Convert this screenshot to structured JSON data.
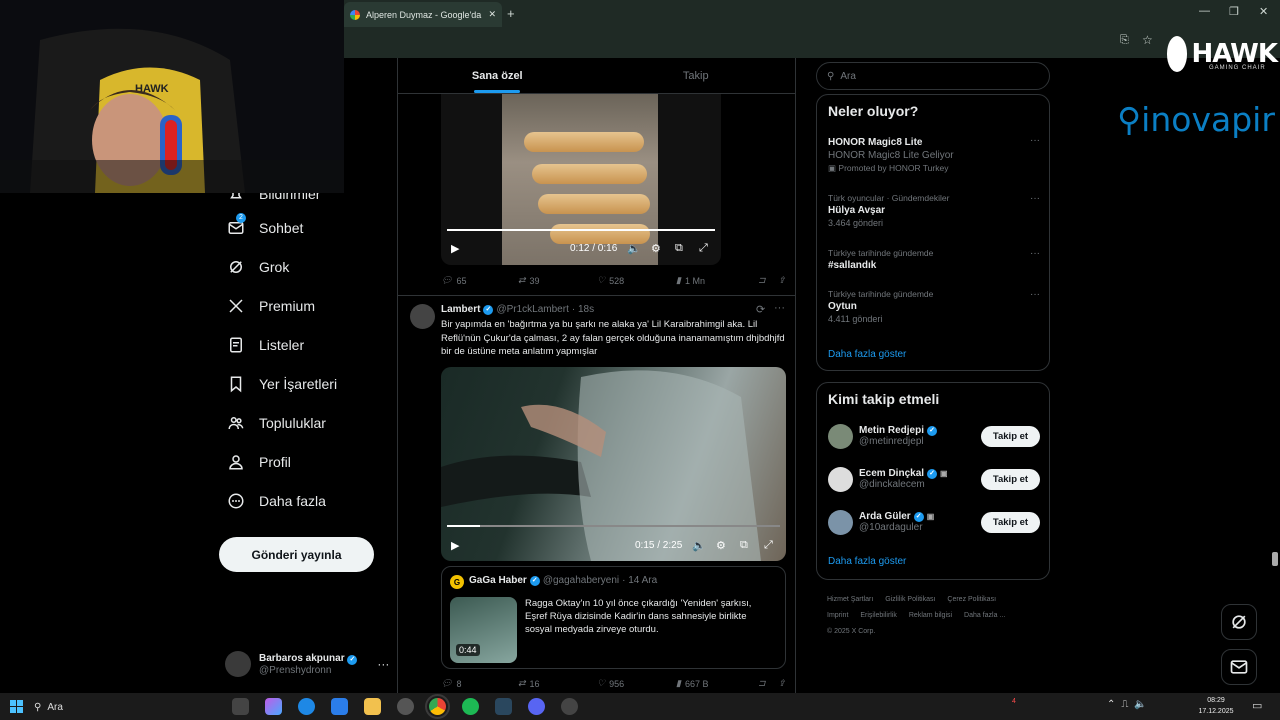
{
  "browser": {
    "tab_title": "Alperen Duymaz - Google'da A",
    "new_tab": "+",
    "win_min": "—",
    "win_restore": "❐",
    "win_close": "✕"
  },
  "overlay": {
    "brand": "HAWK",
    "brand_sub": "GAMING CHAIR",
    "sponsor": "inovapir"
  },
  "nav": {
    "items": [
      {
        "label": "Bildirimler",
        "icon": "bell-icon"
      },
      {
        "label": "Sohbet",
        "icon": "chat-icon",
        "badge": "2"
      },
      {
        "label": "Grok",
        "icon": "grok-icon"
      },
      {
        "label": "Premium",
        "icon": "x-icon"
      },
      {
        "label": "Listeler",
        "icon": "list-icon"
      },
      {
        "label": "Yer İşaretleri",
        "icon": "bookmark-icon"
      },
      {
        "label": "Topluluklar",
        "icon": "people-icon"
      },
      {
        "label": "Profil",
        "icon": "person-icon"
      },
      {
        "label": "Daha fazla",
        "icon": "more-circle-icon"
      }
    ],
    "post_button": "Gönderi yayınla",
    "account_name": "Barbaros akpunar",
    "account_handle": "@Prenshydronn",
    "account_more": "···"
  },
  "feed": {
    "tabs": [
      "Sana özel",
      "Takip"
    ],
    "post1": {
      "video_time": "0:12 / 0:16",
      "video_progress": 1.0,
      "replies": "65",
      "reposts": "39",
      "likes": "528",
      "views": "1 Mn"
    },
    "post2": {
      "name": "Lambert",
      "handle": "@Pr1ckLambert",
      "time": "· 18s",
      "text": "Bir yapımda en 'bağırtma ya bu şarkı ne alaka ya' Lil Karaibrahimgil aka. Lil Reflü'nün Çukur'da çalması, 2 ay falan gerçek olduğuna inanamamıştım dhjbdhjfd bir de üstüne meta anlatım yapmışlar",
      "video_time": "0:15 / 2:25",
      "video_progress": 0.1,
      "quote": {
        "name": "GaGa Haber",
        "handle": "@gagahaberyeni",
        "time": "· 14 Ara",
        "text": "Ragga Oktay'ın 10 yıl önce çıkardığı 'Yeniden' şarkısı, Eşref Rüya dizisinde Kadir'in dans sahnesiyle birlikte sosyal medyada zirveye oturdu.",
        "duration": "0:44"
      },
      "replies": "8",
      "reposts": "16",
      "likes": "956",
      "views": "667 B"
    }
  },
  "sidebar": {
    "search_placeholder": "Ara",
    "trends_title": "Neler oluyor?",
    "trends": [
      {
        "context": "",
        "title": "HONOR Magic8 Lite",
        "sub": "HONOR Magic8 Lite Geliyor",
        "promo": "Promoted by HONOR Turkey"
      },
      {
        "context": "Türk oyuncular · Gündemdekiler",
        "title": "Hülya Avşar",
        "sub": "3.464 gönderi"
      },
      {
        "context": "Türkiye tarihinde gündemde",
        "title": "#sallandık",
        "sub": ""
      },
      {
        "context": "Türkiye tarihinde gündemde",
        "title": "Oytun",
        "sub": "4.411 gönderi"
      }
    ],
    "trends_more": "Daha fazla göster",
    "who_title": "Kimi takip etmeli",
    "who": [
      {
        "name": "Metin Redjepi",
        "handle": "@metinredjepl",
        "button": "Takip et"
      },
      {
        "name": "Ecem Dinçkal",
        "handle": "@dinckalecem",
        "button": "Takip et"
      },
      {
        "name": "Arda Güler",
        "handle": "@10ardaguler",
        "button": "Takip et"
      }
    ],
    "who_more": "Daha fazla göster",
    "footer": [
      "Hizmet Şartları",
      "Gizlilik Politikası",
      "Çerez Politikası",
      "Imprint",
      "Erişilebilirlik",
      "Reklam bilgisi",
      "Daha fazla ...",
      "© 2025 X Corp."
    ]
  },
  "taskbar": {
    "search": "Ara",
    "time": "08:29",
    "date": "17.12.2025",
    "notif_count": "4"
  },
  "colors": {
    "accent": "#1d9bf0",
    "chrome": "#1f2a25"
  }
}
